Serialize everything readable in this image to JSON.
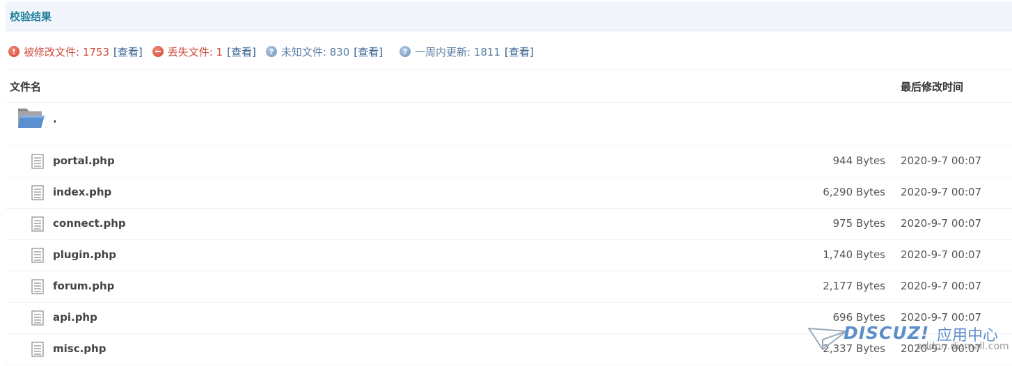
{
  "header": {
    "title": "校验结果"
  },
  "summary": [
    {
      "icon": "warning-icon",
      "label": "被修改文件: 1753",
      "link": "[查看]",
      "tone": "red"
    },
    {
      "icon": "stop-icon",
      "label": "丢失文件: 1",
      "link": "[查看]",
      "tone": "red"
    },
    {
      "icon": "question-icon",
      "label": "未知文件: 830",
      "link": "[查看]",
      "tone": "blue"
    },
    {
      "icon": "question-icon",
      "label": "一周内更新: 1811",
      "link": "[查看]",
      "tone": "blue"
    }
  ],
  "table": {
    "col_name": "文件名",
    "col_time": "最后修改时间",
    "folder": {
      "name": ".",
      "icon": "folder-icon"
    },
    "rows": [
      {
        "name": "portal.php",
        "size": "944 Bytes",
        "date": "2020-9-7 00:07"
      },
      {
        "name": "index.php",
        "size": "6,290 Bytes",
        "date": "2020-9-7 00:07"
      },
      {
        "name": "connect.php",
        "size": "975 Bytes",
        "date": "2020-9-7 00:07"
      },
      {
        "name": "plugin.php",
        "size": "1,740 Bytes",
        "date": "2020-9-7 00:07"
      },
      {
        "name": "forum.php",
        "size": "2,177 Bytes",
        "date": "2020-9-7 00:07"
      },
      {
        "name": "api.php",
        "size": "696 Bytes",
        "date": "2020-9-7 00:07"
      },
      {
        "name": "misc.php",
        "size": "2,337 Bytes",
        "date": "2020-9-7 00:07"
      }
    ]
  },
  "watermark": {
    "brand": "DISCUZ!",
    "sub": "应用中心",
    "url": "addon.dismall.com"
  },
  "colors": {
    "title": "#21809b",
    "red": "#cf4a3b",
    "blue": "#5c7da4",
    "link": "#2b5a8c"
  }
}
